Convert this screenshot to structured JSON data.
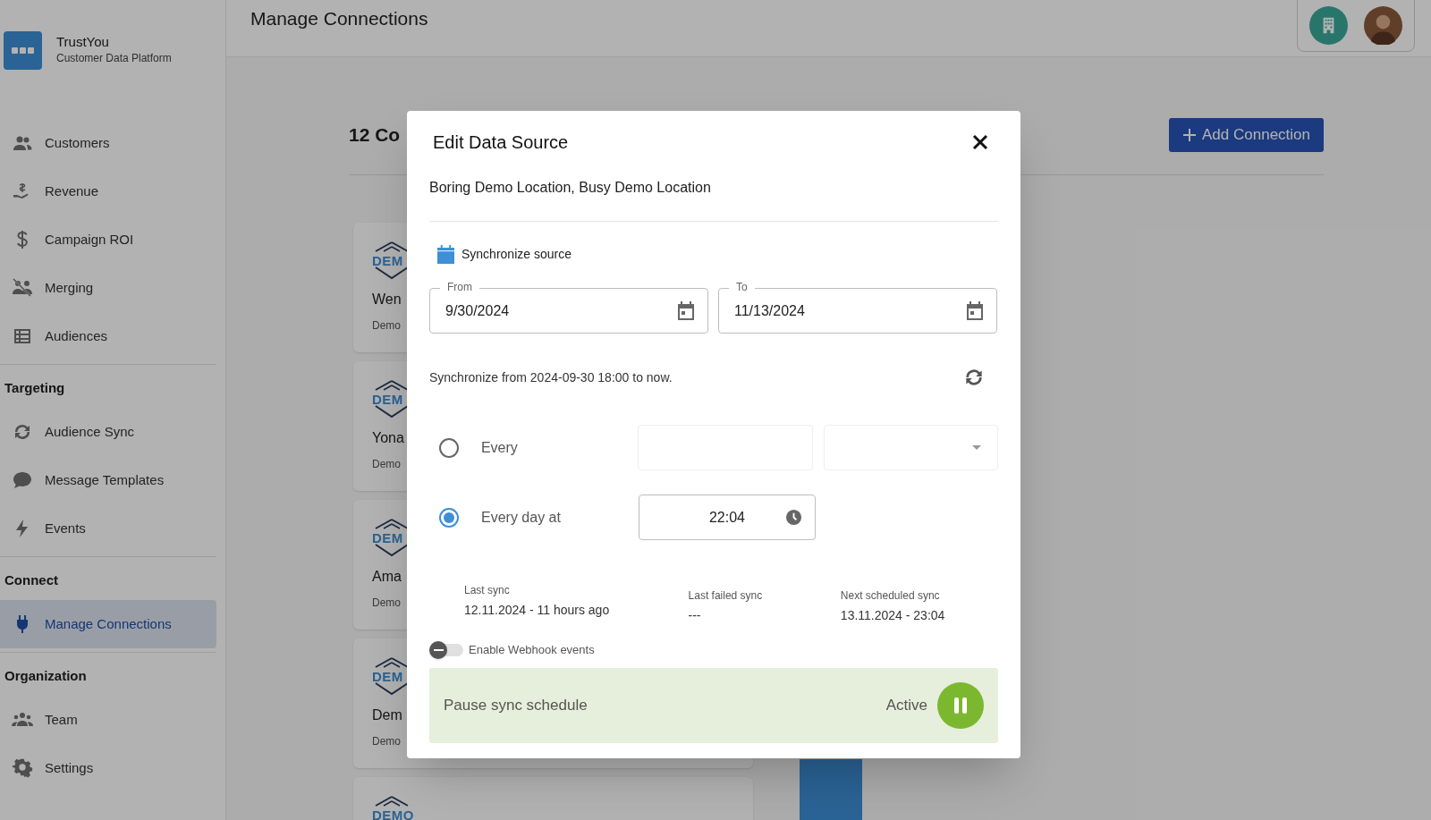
{
  "app": {
    "name": "TrustYou",
    "subtitle": "Customer Data Platform"
  },
  "sidebar": {
    "sections": [
      {
        "items": [
          {
            "label": "Customers",
            "selected": false
          },
          {
            "label": "Revenue",
            "selected": false
          },
          {
            "label": "Campaign ROI",
            "selected": false
          },
          {
            "label": "Merging",
            "selected": false
          },
          {
            "label": "Audiences",
            "selected": false
          }
        ]
      },
      {
        "heading": "Targeting",
        "items": [
          {
            "label": "Audience Sync",
            "selected": false
          },
          {
            "label": "Message Templates",
            "selected": false
          },
          {
            "label": "Events",
            "selected": false
          }
        ]
      },
      {
        "heading": "Connect",
        "items": [
          {
            "label": "Manage Connections",
            "selected": true
          }
        ]
      },
      {
        "heading": "Organization",
        "items": [
          {
            "label": "Team",
            "selected": false
          },
          {
            "label": "Settings",
            "selected": false
          }
        ]
      }
    ]
  },
  "header": {
    "title": "Manage Connections"
  },
  "page": {
    "count_heading": "12 Co",
    "add_button": "Add Connection"
  },
  "cards": [
    {
      "logo": "DEM",
      "name": "Wen",
      "subtitle": "Demo"
    },
    {
      "logo": "DEM",
      "name": "Yona",
      "subtitle": "Demo"
    },
    {
      "logo": "DEM",
      "name": "Ama",
      "subtitle": "Demo"
    },
    {
      "logo": "DEM",
      "name": "Dem",
      "subtitle": "Demo"
    },
    {
      "logo": "DEMO"
    }
  ],
  "modal": {
    "title": "Edit Data Source",
    "subtitle": "Boring Demo Location, Busy Demo Location",
    "section": "Synchronize source",
    "from": {
      "label": "From",
      "value": "9/30/2024"
    },
    "to": {
      "label": "To",
      "value": "11/13/2024"
    },
    "sync_note": "Synchronize from 2024-09-30 18:00 to now.",
    "schedule": [
      {
        "kind": "interval",
        "label": "Every",
        "selected": false
      },
      {
        "kind": "time",
        "label": "Every day at",
        "selected": true,
        "value": "22:04"
      }
    ],
    "stats": [
      {
        "label": "Last sync",
        "value": "12.11.2024 - 11 hours ago"
      },
      {
        "label": "Last failed sync",
        "value": "---"
      },
      {
        "label": "Next scheduled sync",
        "value": "13.11.2024 - 23:04"
      }
    ],
    "webhook": {
      "label": "Enable Webhook events",
      "on": false
    },
    "pause": {
      "label": "Pause sync schedule",
      "status": "Active",
      "paused": false
    }
  }
}
